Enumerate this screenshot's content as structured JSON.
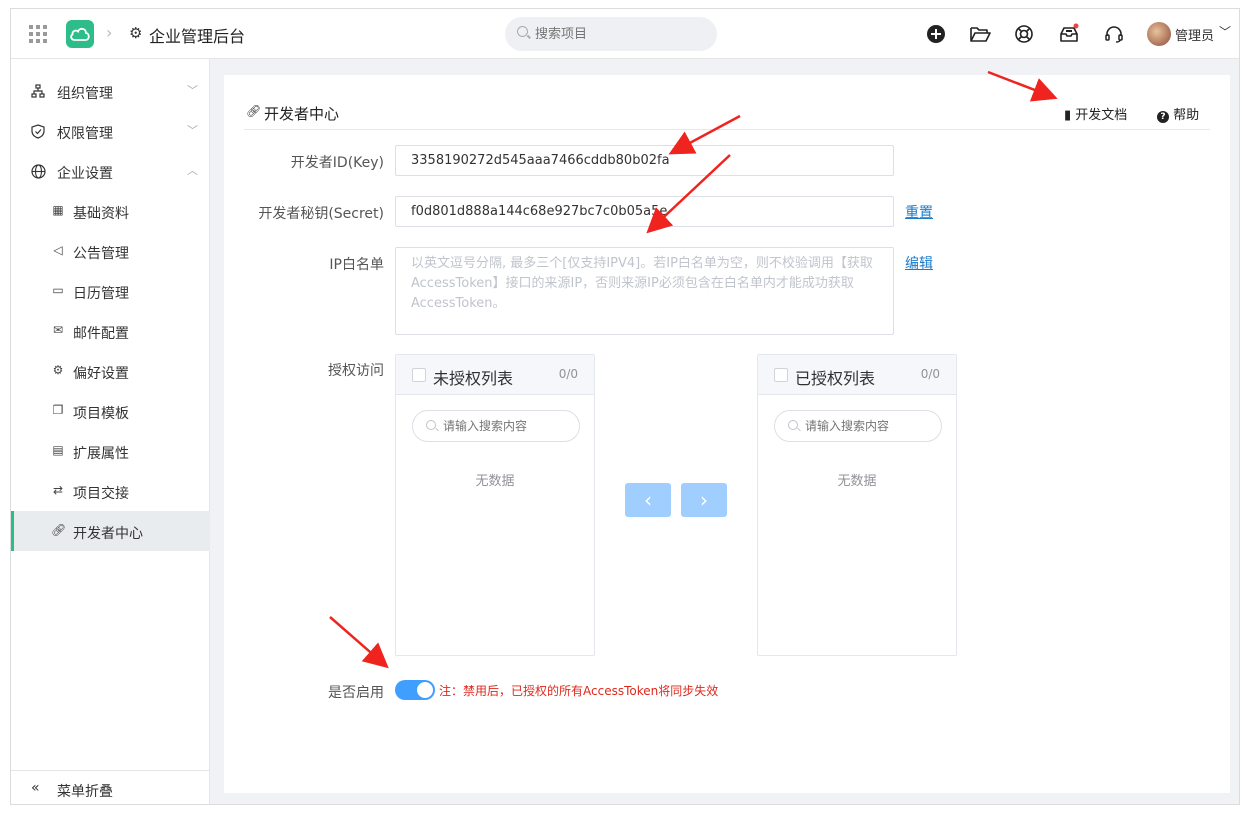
{
  "header": {
    "app_title": "企业管理后台",
    "search_placeholder": "搜索项目",
    "username": "管理员"
  },
  "sidebar": {
    "groups": [
      {
        "label": "组织管理",
        "icon": "org-chart-icon",
        "expanded": false
      },
      {
        "label": "权限管理",
        "icon": "shield-icon",
        "expanded": false
      },
      {
        "label": "企业设置",
        "icon": "globe-icon",
        "expanded": true
      }
    ],
    "items": [
      {
        "label": "基础资料",
        "icon": "grid-icon"
      },
      {
        "label": "公告管理",
        "icon": "megaphone-icon"
      },
      {
        "label": "日历管理",
        "icon": "calendar-icon"
      },
      {
        "label": "邮件配置",
        "icon": "mail-icon"
      },
      {
        "label": "偏好设置",
        "icon": "gear-icon"
      },
      {
        "label": "项目模板",
        "icon": "copy-icon"
      },
      {
        "label": "扩展属性",
        "icon": "document-icon"
      },
      {
        "label": "项目交接",
        "icon": "swap-icon"
      },
      {
        "label": "开发者中心",
        "icon": "link-icon",
        "active": true
      }
    ],
    "collapse_label": "菜单折叠"
  },
  "main": {
    "title": "开发者中心",
    "doc_link": "开发文档",
    "help_link": "帮助",
    "fields": {
      "key_label": "开发者ID(Key)",
      "key_value": "3358190272d545aaa7466cddb80b02fa",
      "secret_label": "开发者秘钥(Secret)",
      "secret_value": "f0d801d888a144c68e927bc7c0b05a5e",
      "reset_link": "重置",
      "whitelist_label": "IP白名单",
      "whitelist_placeholder": "以英文逗号分隔, 最多三个[仅支持IPV4]。若IP白名单为空，则不校验调用【获取AccessToken】接口的来源IP，否则来源IP必须包含在白名单内才能成功获取AccessToken。",
      "edit_link": "编辑",
      "auth_label": "授权访问",
      "enable_label": "是否启用",
      "enable_on": true,
      "enable_note": "注：禁用后，已授权的所有AccessToken将同步失效"
    },
    "transfer": {
      "left_title": "未授权列表",
      "left_count": "0/0",
      "right_title": "已授权列表",
      "right_count": "0/0",
      "search_placeholder": "请输入搜索内容",
      "empty_text": "无数据",
      "to_left": "‹",
      "to_right": "›"
    }
  },
  "colors": {
    "brand": "#2ebc8a",
    "link": "#1a7bc9",
    "switch_on": "#409eff",
    "transfer_button": "#a0cfff",
    "note": "#e0281e",
    "annotation_arrow": "#f0241e"
  }
}
